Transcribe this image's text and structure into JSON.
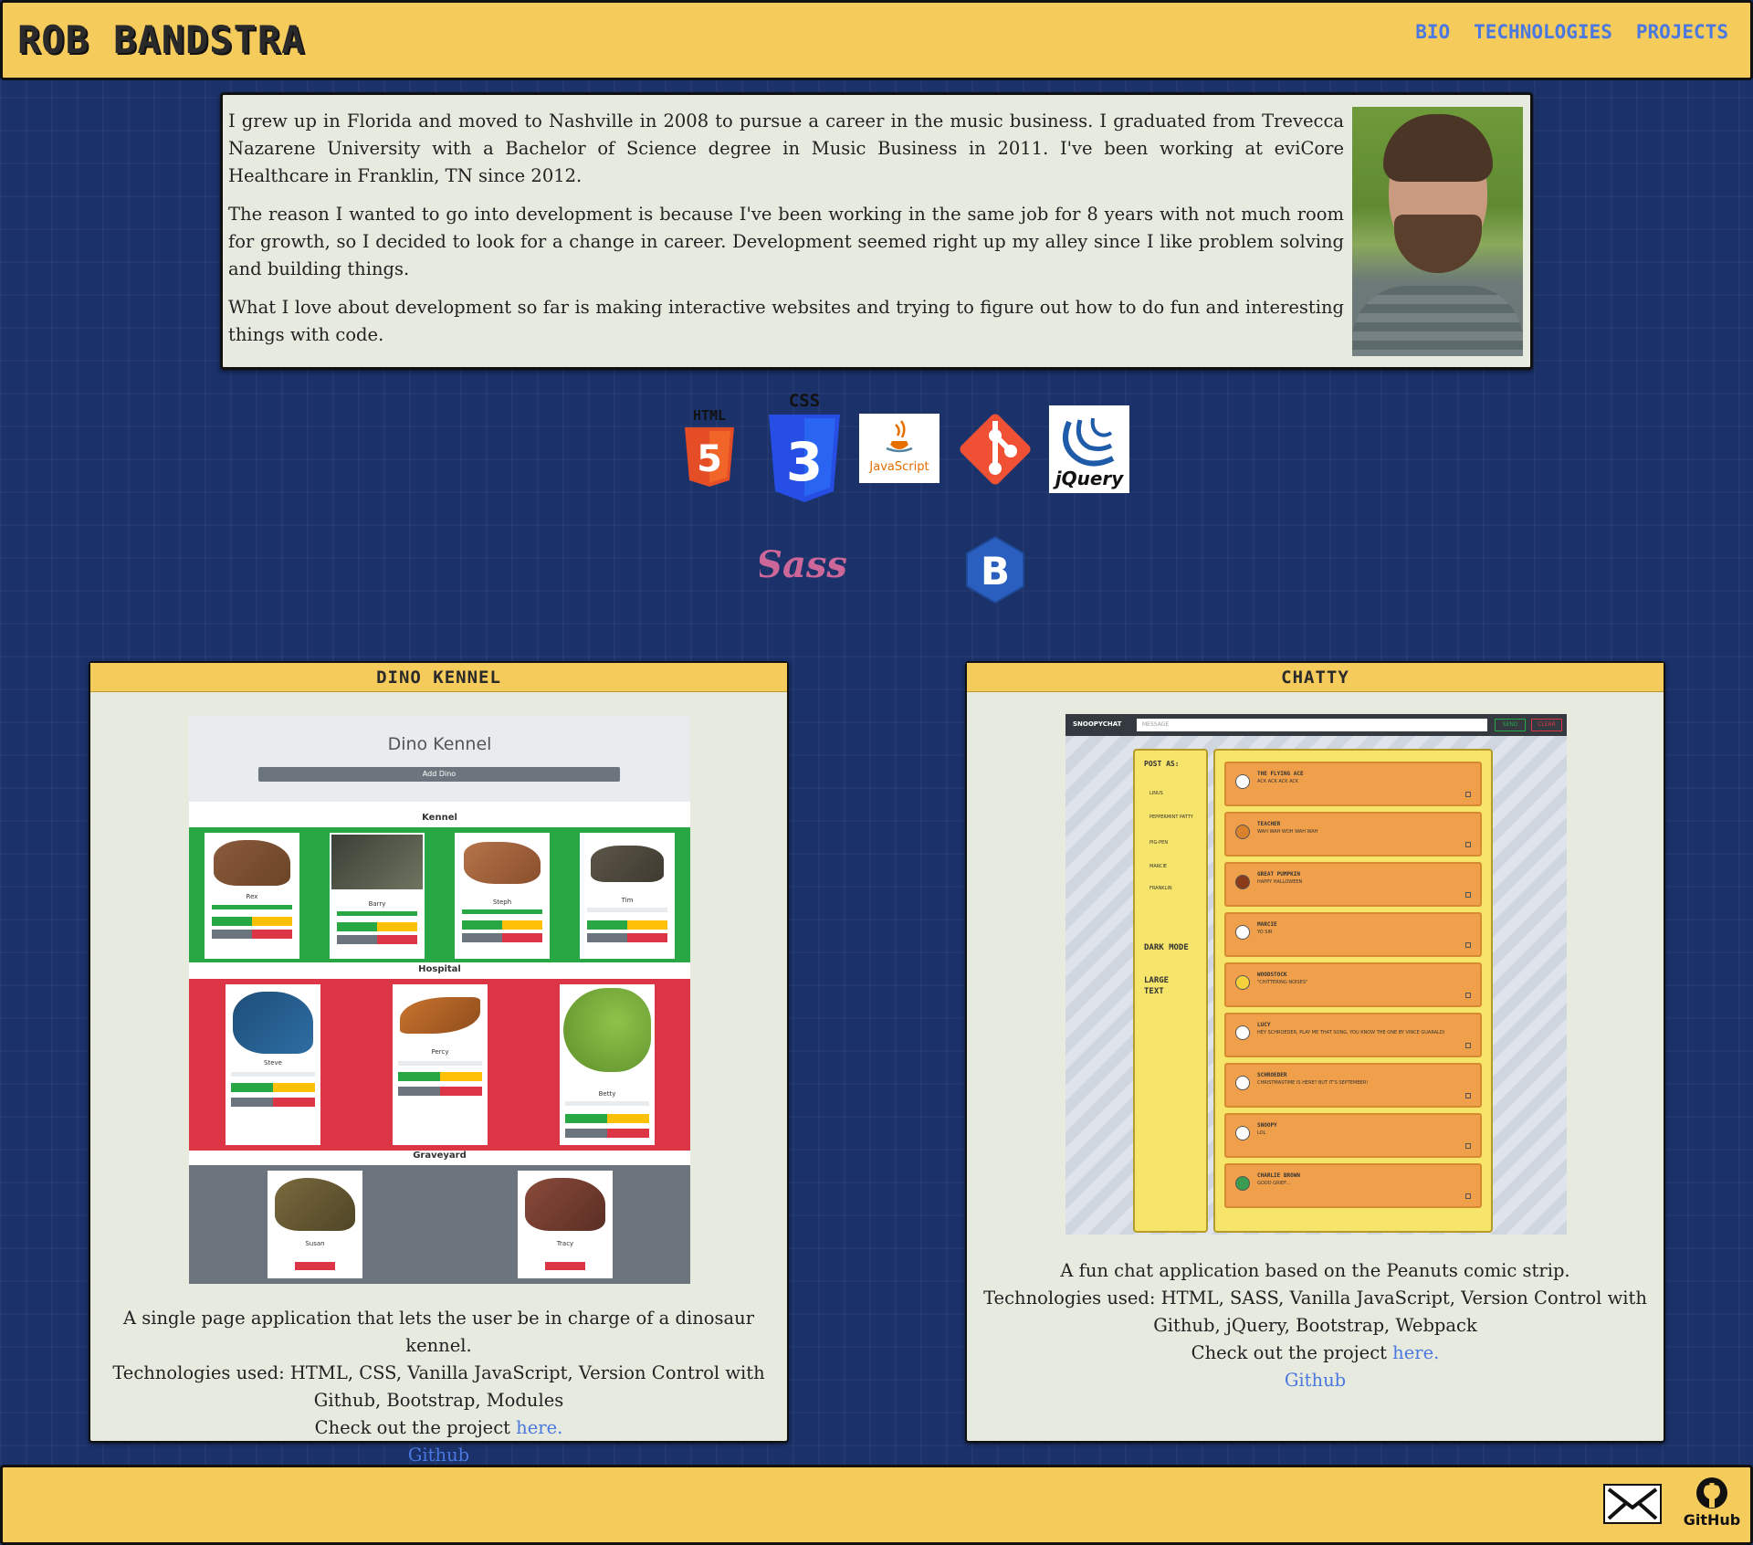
{
  "header": {
    "brand": "ROB BANDSTRA",
    "nav": [
      "BIO",
      "TECHNOLOGIES",
      "PROJECTS"
    ]
  },
  "bio": {
    "paragraphs": [
      "I grew up in Florida and moved to Nashville in 2008 to pursue a career in the music business. I graduated from Trevecca Nazarene University with a Bachelor of Science degree in Music Business in 2011. I've been working at eviCore Healthcare in Franklin, TN since 2012.",
      "The reason I wanted to go into development is because I've been working in the same job for 8 years with not much room for growth, so I decided to look for a change in career. Development seemed right up my alley since I like problem solving and building things.",
      "What I love about development so far is making interactive websites and trying to figure out how to do fun and interesting things with code."
    ]
  },
  "technologies": {
    "html_label": "HTML",
    "html_num": "5",
    "css_label": "CSS",
    "css_num": "3",
    "javascript_label": "JavaScript",
    "jquery_label": "jQuery",
    "sass_label": "Sass",
    "bootstrap_label": "B"
  },
  "projects": [
    {
      "title": "DINO KENNEL",
      "shot": {
        "app_title": "Dino Kennel",
        "add_button": "Add Dino",
        "kennel_label": "Kennel",
        "hospital_label": "Hospital",
        "graveyard_label": "Graveyard",
        "kennel_dinos": [
          "Rex",
          "Barry",
          "Steph",
          "Tim"
        ],
        "hospital_dinos": [
          "Steve",
          "Percy",
          "Betty"
        ],
        "graveyard_dinos": [
          "Susan",
          "Tracy"
        ]
      },
      "description": "A single page application that lets the user be in charge of a dinosaur kennel.",
      "tech": "Technologies used: HTML, CSS, Vanilla JavaScript, Version Control with Github, Bootstrap, Modules",
      "check": "Check out the project",
      "link": "here.",
      "github": "Github"
    },
    {
      "title": "CHATTY",
      "shot": {
        "app_name": "SNOOPYCHAT",
        "message_placeholder": "MESSAGE",
        "send": "SEND",
        "clear": "CLEAR",
        "post_as": "POST AS:",
        "users": [
          "LINUS",
          "PEPPERMINT PATTY",
          "PIG-PEN",
          "MARCIE",
          "FRANKLIN"
        ],
        "dark_mode": "DARK MODE",
        "large_text": "LARGE TEXT",
        "messages": [
          {
            "name": "THE FLYING ACE",
            "text": "ACK ACK ACK ACK"
          },
          {
            "name": "TEACHER",
            "text": "WAH WAH WOH WAH WAH"
          },
          {
            "name": "GREAT PUMPKIN",
            "text": "HAPPY HALLOWEEN"
          },
          {
            "name": "MARCIE",
            "text": "YO SIR"
          },
          {
            "name": "WOODSTOCK",
            "text": "\"CHITTERING NOISES\""
          },
          {
            "name": "LUCY",
            "text": "HEY SCHROEDER, PLAY ME THAT SONG, YOU KNOW THE ONE BY VINCE GUARALDI"
          },
          {
            "name": "SCHROEDER",
            "text": "CHRISTMASTIME IS HERE? BUT IT'S SEPTEMBER!"
          },
          {
            "name": "SNOOPY",
            "text": "LOL"
          },
          {
            "name": "CHARLIE BROWN",
            "text": "GOOD GRIEF..."
          }
        ]
      },
      "description": "A fun chat application based on the Peanuts comic strip.",
      "tech": "Technologies used: HTML, SASS, Vanilla JavaScript, Version Control with Github, jQuery, Bootstrap, Webpack",
      "check": "Check out the project",
      "link": "here.",
      "github": "Github"
    }
  ],
  "footer": {
    "github_label": "GitHub"
  },
  "colors": {
    "background": "#1a3169",
    "accent": "#f5cb5c",
    "card": "#e7eadf",
    "link": "#4a78e0"
  }
}
